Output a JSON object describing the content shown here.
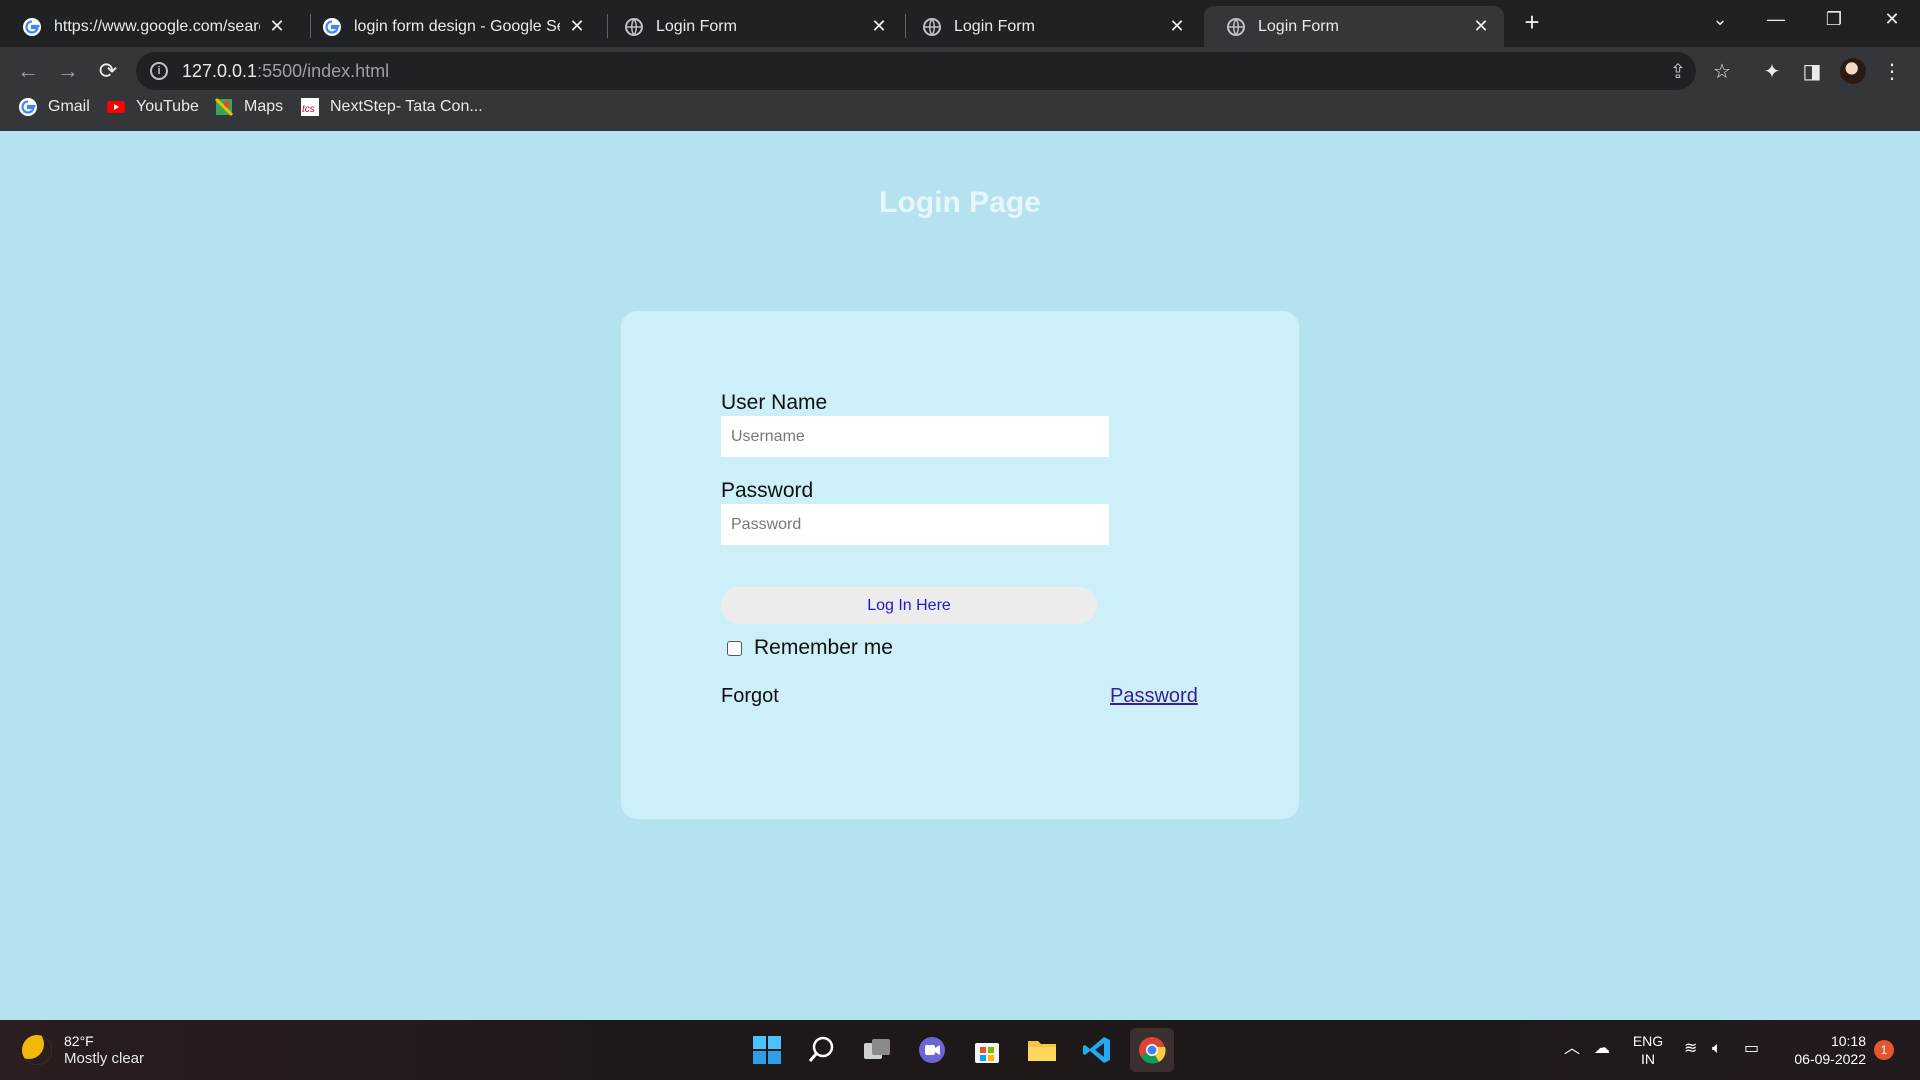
{
  "browser": {
    "tabs": [
      {
        "title": "https://www.google.com/search?",
        "icon": "google-g-icon"
      },
      {
        "title": "login form design - Google Searc",
        "icon": "google-g-icon"
      },
      {
        "title": "Login Form",
        "icon": "globe-icon"
      },
      {
        "title": "Login Form",
        "icon": "globe-icon"
      },
      {
        "title": "Login Form",
        "icon": "globe-icon",
        "active": true
      }
    ],
    "url_host": "127.0.0.1",
    "url_path": ":5500/index.html",
    "bookmarks": [
      {
        "label": "Gmail",
        "icon": "google-g-icon"
      },
      {
        "label": "YouTube",
        "icon": "youtube-icon"
      },
      {
        "label": "Maps",
        "icon": "maps-icon"
      },
      {
        "label": "NextStep- Tata Con...",
        "icon": "tcs-icon"
      }
    ]
  },
  "page": {
    "title": "Login Page",
    "username_label": "User Name",
    "username_placeholder": "Username",
    "password_label": "Password",
    "password_placeholder": "Password",
    "login_button": "Log In Here",
    "remember_label": "Remember me",
    "forgot_text": "Forgot",
    "forgot_link": "Password"
  },
  "taskbar": {
    "weather_temp": "82°F",
    "weather_desc": "Mostly clear",
    "language": "ENG",
    "region": "IN",
    "time": "10:18",
    "date": "06-09-2022",
    "notification_count": "1"
  },
  "colors": {
    "page_bg": "#b4e2ee",
    "card_bg": "#cdeff8",
    "link": "#3b1e96",
    "button_text": "#1a1ad4"
  }
}
